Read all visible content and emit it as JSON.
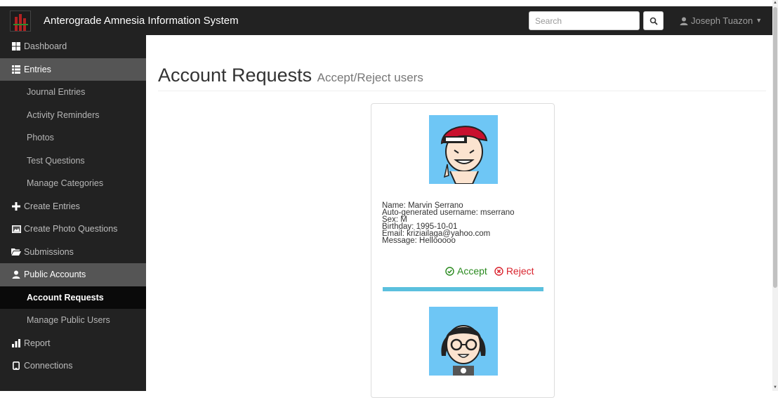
{
  "app": {
    "title": "Anterograde Amnesia Information System"
  },
  "search": {
    "placeholder": "Search"
  },
  "user": {
    "name": "Joseph Tuazon"
  },
  "sidebar": {
    "items": [
      {
        "label": "Dashboard",
        "icon": "dashboard-icon"
      },
      {
        "label": "Entries",
        "icon": "list-icon"
      },
      {
        "label": "Journal Entries"
      },
      {
        "label": "Activity Reminders"
      },
      {
        "label": "Photos"
      },
      {
        "label": "Test Questions"
      },
      {
        "label": "Manage Categories"
      },
      {
        "label": "Create Entries",
        "icon": "plus-icon"
      },
      {
        "label": "Create Photo Questions",
        "icon": "picture-icon"
      },
      {
        "label": "Submissions",
        "icon": "folder-open-icon"
      },
      {
        "label": "Public Accounts",
        "icon": "user-icon"
      },
      {
        "label": "Account Requests"
      },
      {
        "label": "Manage Public Users"
      },
      {
        "label": "Report",
        "icon": "bar-chart-icon"
      },
      {
        "label": "Connections",
        "icon": "phone-icon"
      }
    ]
  },
  "page": {
    "title": "Account Requests",
    "subtitle": "Accept/Reject users"
  },
  "requests": [
    {
      "name": "Name: Marvin Serrano",
      "username": "Auto-generated username: mserrano",
      "sex": "Sex: M",
      "birthday": "Birthday: 1995-10-01",
      "email": "Email: kriziailaga@yahoo.com",
      "message": "Message: Hellooooo",
      "accept_label": "Accept",
      "reject_label": "Reject"
    }
  ],
  "colors": {
    "topbar": "#222222",
    "sidebar": "#222222",
    "sidebar_active": "#555555",
    "sidebar_current": "#0a0a0a",
    "accept": "#2a8a1f",
    "reject": "#d9232d",
    "divider": "#5bc0de",
    "avatar_bg": "#6ec6f5"
  }
}
